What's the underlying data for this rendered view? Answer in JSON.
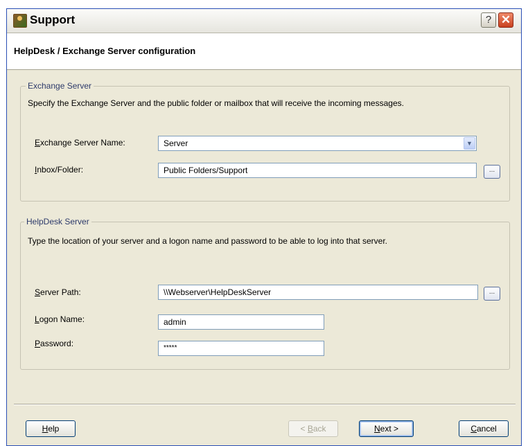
{
  "window": {
    "title": "Support",
    "help_glyph": "?",
    "close_glyph": "✕"
  },
  "header": {
    "title": "HelpDesk / Exchange Server configuration"
  },
  "exchange_group": {
    "legend": "Exchange Server",
    "description": "Specify the Exchange Server and the public folder or mailbox that will receive the incoming messages.",
    "server_name_label_mnemonic": "E",
    "server_name_label_rest": "xchange Server Name:",
    "server_name_value": "Server",
    "inbox_label_mnemonic": "I",
    "inbox_label_rest": "nbox/Folder:",
    "inbox_value": "Public Folders/Support",
    "browse_label": "..."
  },
  "helpdesk_group": {
    "legend": "HelpDesk Server",
    "description": "Type the location of your server and a logon name and password to be able to log into that server.",
    "server_path_label_mnemonic": "S",
    "server_path_label_rest": "erver Path:",
    "server_path_value": "\\\\Webserver\\HelpDeskServer",
    "browse_label": "...",
    "logon_label_mnemonic": "L",
    "logon_label_rest": "ogon Name:",
    "logon_value": "admin",
    "password_label_mnemonic": "P",
    "password_label_rest": "assword:",
    "password_value": "*****"
  },
  "buttons": {
    "help_mnemonic": "H",
    "help_rest": "elp",
    "back_prefix": "< ",
    "back_mnemonic": "B",
    "back_rest": "ack",
    "next_mnemonic": "N",
    "next_rest": "ext >",
    "cancel_mnemonic": "C",
    "cancel_rest": "ancel"
  },
  "icons": {
    "app": "support-app-icon",
    "combo": "chevron-down-icon"
  }
}
